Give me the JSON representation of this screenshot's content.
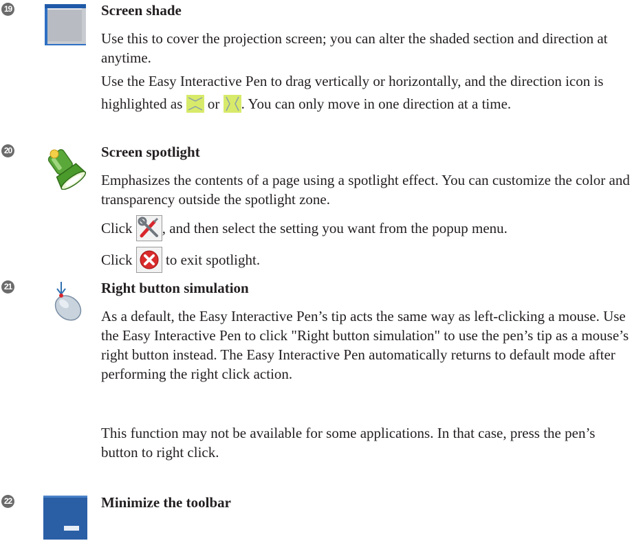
{
  "entries": [
    {
      "number": "19",
      "icon": "screen-shade-icon",
      "title": "Screen shade",
      "p1": "Use this to cover the projection screen; you can alter the shaded section and direction at anytime.",
      "p2_a": "Use the Easy Interactive Pen to drag vertically or horizontally, and the direction icon is highlighted as",
      "p2_or": "or",
      "p2_b": ". You can only move in one direction at a time."
    },
    {
      "number": "20",
      "icon": "spotlight-flashlight-icon",
      "title": "Screen spotlight",
      "p1": "Emphasizes the contents of a page using a spotlight effect. You can customize the color and transparency outside the spotlight zone.",
      "p2_a": "Click",
      "p2_b": ", and then select the setting you want from the popup menu.",
      "p3_a": "Click",
      "p3_b": "to exit spotlight."
    },
    {
      "number": "21",
      "icon": "mouse-right-button-icon",
      "title": "Right button simulation",
      "p1": "As a default, the Easy Interactive Pen’s tip acts the same way as left-clicking a mouse. Use the Easy Interactive Pen to click \"Right button simulation\" to use the pen’s tip as a mouse’s right button instead. The Easy Interactive Pen automatically returns to default mode after performing the right click action.",
      "p2": "This function may not be available for some applications. In that case, press the pen’s button to right click."
    },
    {
      "number": "22",
      "icon": "minimize-toolbar-icon",
      "title": "Minimize the toolbar"
    }
  ]
}
